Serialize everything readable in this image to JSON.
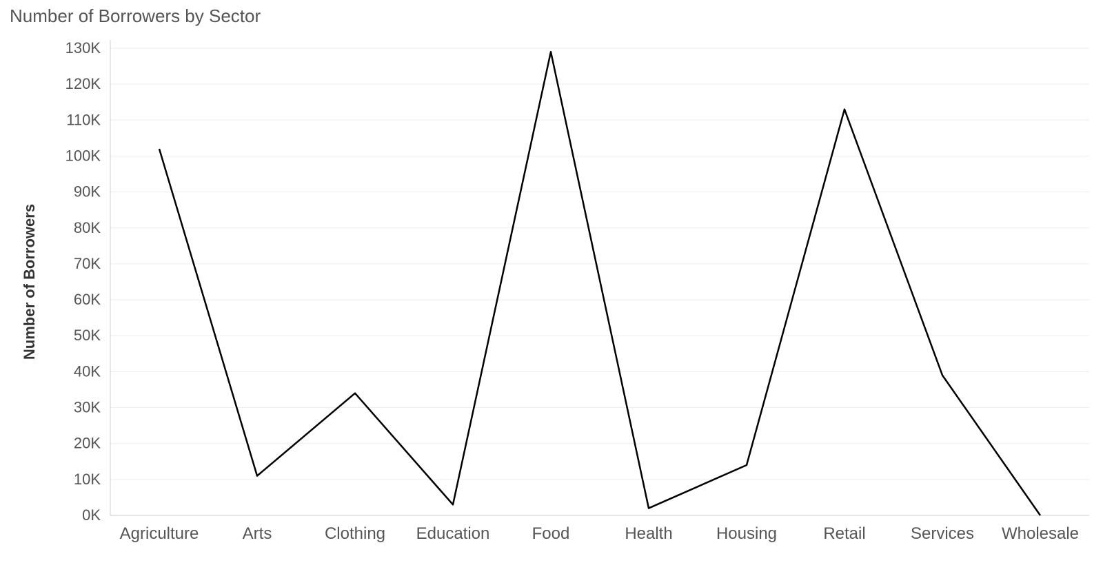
{
  "chart_data": {
    "type": "line",
    "title": "Number of Borrowers by Sector",
    "ylabel": "Number of Borrowers",
    "ylim": [
      0,
      130000
    ],
    "y_ticks": [
      0,
      10000,
      20000,
      30000,
      40000,
      50000,
      60000,
      70000,
      80000,
      90000,
      100000,
      110000,
      120000,
      130000
    ],
    "y_tick_labels": [
      "0K",
      "10K",
      "20K",
      "30K",
      "40K",
      "50K",
      "60K",
      "70K",
      "80K",
      "90K",
      "100K",
      "110K",
      "120K",
      "130K"
    ],
    "categories": [
      "Agriculture",
      "Arts",
      "Clothing",
      "Education",
      "Food",
      "Health",
      "Housing",
      "Retail",
      "Services",
      "Wholesale"
    ],
    "values": [
      102000,
      11000,
      34000,
      3000,
      129000,
      2000,
      14000,
      113000,
      39000,
      0
    ],
    "colors": {
      "line": "#000000",
      "grid": "#eeeeee",
      "axis": "#cccccc",
      "text": "#555555"
    }
  }
}
